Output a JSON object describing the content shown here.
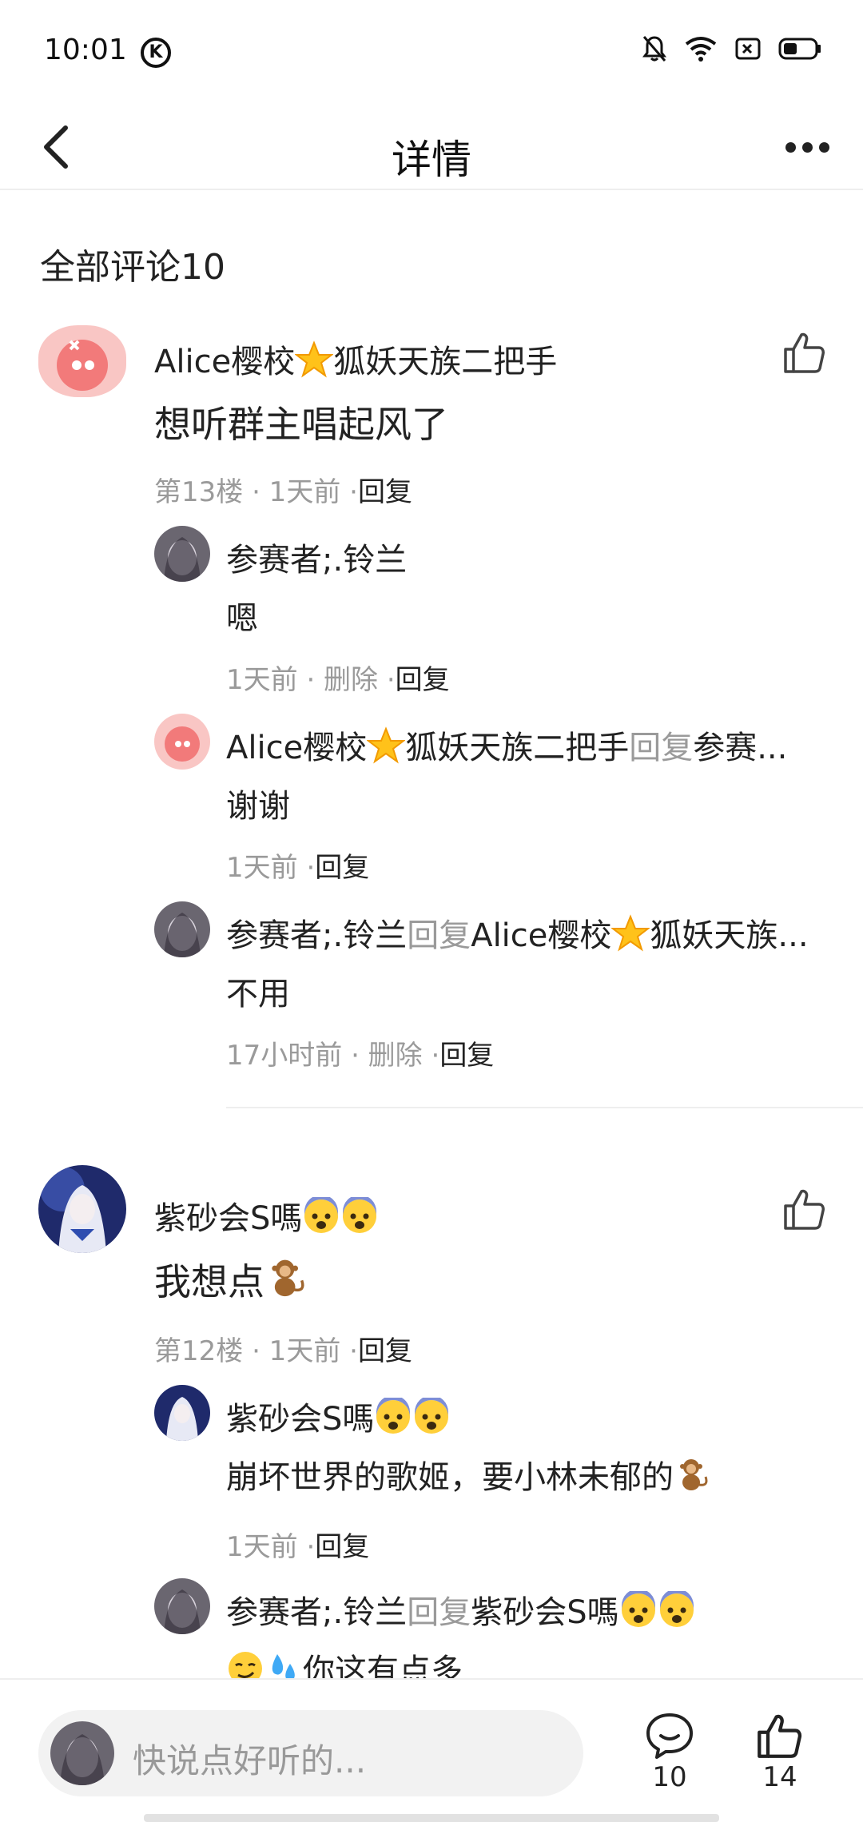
{
  "status_bar": {
    "time": "10:01",
    "k_badge": "K",
    "icons": [
      "mute-bell-icon",
      "wifi-icon",
      "sim-icon",
      "battery-icon"
    ]
  },
  "header": {
    "title": "详情",
    "back_icon": "chevron-left-icon",
    "more_icon": "more-dots-icon"
  },
  "section": {
    "title": "全部评论10"
  },
  "comments": [
    {
      "name_a": "Alice樱校",
      "name_b": "狐妖天族二把手",
      "body": "想听群主唱起风了",
      "meta": "第13楼 · 1天前 ·",
      "reply_action": "回复",
      "replies": [
        {
          "name": "参赛者;.铃兰",
          "body": "嗯",
          "meta": "1天前 · 删除 ·",
          "reply_action": "回复"
        },
        {
          "name_a": "Alice樱校",
          "name_b": "狐妖天族二把手",
          "reply_word": "回复",
          "target": "参赛...",
          "body": "谢谢",
          "meta": "1天前 ·",
          "reply_action": "回复"
        },
        {
          "name": "参赛者;.铃兰",
          "reply_word": "回复",
          "target_a": "Alice樱校",
          "target_b": "狐妖天族...",
          "body": "不用",
          "meta": "17小时前 · 删除 ·",
          "reply_action": "回复"
        }
      ]
    },
    {
      "name": "紫砂会S嗎",
      "body": "我想点",
      "meta": "第12楼 · 1天前 ·",
      "reply_action": "回复",
      "replies": [
        {
          "name": "紫砂会S嗎",
          "body": "崩坏世界的歌姬，要小林未郁的",
          "meta": "1天前 ·",
          "reply_action": "回复"
        },
        {
          "name": "参赛者;.铃兰",
          "reply_word": "回复",
          "target": "紫砂会S嗎",
          "body": "你这有点多"
        }
      ]
    }
  ],
  "bottom_bar": {
    "input_placeholder": "快说点好听的...",
    "comment_count": "10",
    "like_count": "14"
  },
  "colors": {
    "meta_gray": "#9a9a9a",
    "text": "#222222",
    "divider": "#eeeeee",
    "input_bg": "#f2f2f2"
  }
}
